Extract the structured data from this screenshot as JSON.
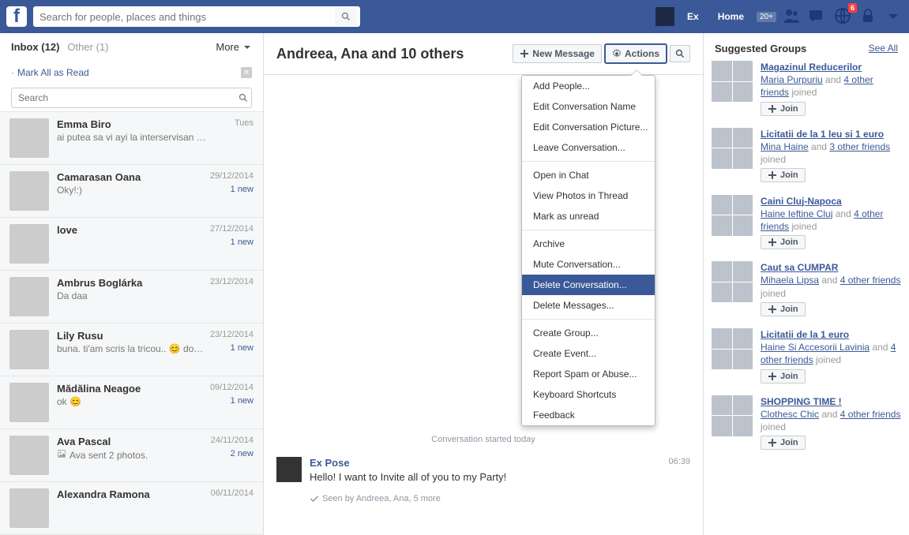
{
  "header": {
    "search_placeholder": "Search for people, places and things",
    "profile_name": "Ex",
    "home_label": "Home",
    "home_count": "20+",
    "notification_count": "6"
  },
  "inbox": {
    "inbox_label": "Inbox",
    "inbox_count": "(12)",
    "other_label": "Other",
    "other_count": "(1)",
    "more_label": "More",
    "mark_all_read": "Mark All as Read",
    "search_placeholder": "Search"
  },
  "conversations": [
    {
      "name": "Emma Biro",
      "date": "Tues",
      "preview": "ai putea sa vi ayi la interservisan …",
      "new": ""
    },
    {
      "name": "Camarasan Oana",
      "date": "29/12/2014",
      "preview": "Oky!:)",
      "new": "1 new"
    },
    {
      "name": "love",
      "date": "27/12/2014",
      "preview": "",
      "new": "1 new"
    },
    {
      "name": "Ambrus Boglárka",
      "date": "23/12/2014",
      "preview": "Da daa",
      "new": ""
    },
    {
      "name": "Lily Rusu",
      "date": "23/12/2014",
      "preview": "buna. ti'am scris la tricou.. 😊 do…",
      "new": "1 new"
    },
    {
      "name": "Mădălina Neagoe",
      "date": "09/12/2014",
      "preview": "ok 😊",
      "new": "1 new"
    },
    {
      "name": "Ava Pascal",
      "date": "24/11/2014",
      "preview": "Ava sent 2 photos.",
      "new": "2 new",
      "attach": true
    },
    {
      "name": "Alexandra Ramona",
      "date": "06/11/2014",
      "preview": "",
      "new": ""
    }
  ],
  "thread": {
    "title": "Andreea, Ana and 10 others",
    "new_message_btn": "New Message",
    "actions_btn": "Actions",
    "started_label": "Conversation started today",
    "sender": "Ex Pose",
    "body": "Hello! I want to Invite all of you to my Party!",
    "time": "06:39",
    "seen": "Seen by Andreea, Ana, 5 more"
  },
  "actions_menu": {
    "groups": [
      [
        "Add People...",
        "Edit Conversation Name",
        "Edit Conversation Picture...",
        "Leave Conversation..."
      ],
      [
        "Open in Chat",
        "View Photos in Thread",
        "Mark as unread"
      ],
      [
        "Archive",
        "Mute Conversation...",
        "Delete Conversation...",
        "Delete Messages..."
      ],
      [
        "Create Group...",
        "Create Event...",
        "Report Spam or Abuse...",
        "Keyboard Shortcuts",
        "Feedback"
      ]
    ],
    "selected": "Delete Conversation..."
  },
  "right": {
    "title": "Suggested Groups",
    "see_all": "See All",
    "join_label": "Join",
    "groups": [
      {
        "name": "Magazinul Reducerilor",
        "who": "Maria Purpuriu",
        "rest": " and ",
        "others": "4 other friends",
        "tail": " joined"
      },
      {
        "name": "Licitatii de la 1 leu si 1 euro",
        "who": "Mina Haine",
        "rest": " and ",
        "others": "3 other friends",
        "tail": " joined"
      },
      {
        "name": "Caini Cluj-Napoca",
        "who": "Haine Ieftine Cluj",
        "rest": " and ",
        "others": "4 other friends",
        "tail": " joined"
      },
      {
        "name": "Caut sa CUMPAR",
        "who": "Mihaela Lipsa",
        "rest": " and ",
        "others": "4 other friends",
        "tail": " joined"
      },
      {
        "name": "Licitatii de la 1 euro",
        "who": "Haine Si Accesorii Lavinia",
        "rest": " and ",
        "others": "4 other friends",
        "tail": " joined"
      },
      {
        "name": "SHOPPING TIME !",
        "who": "Clothesc Chic",
        "rest": " and ",
        "others": "4 other friends",
        "tail": " joined"
      }
    ]
  }
}
